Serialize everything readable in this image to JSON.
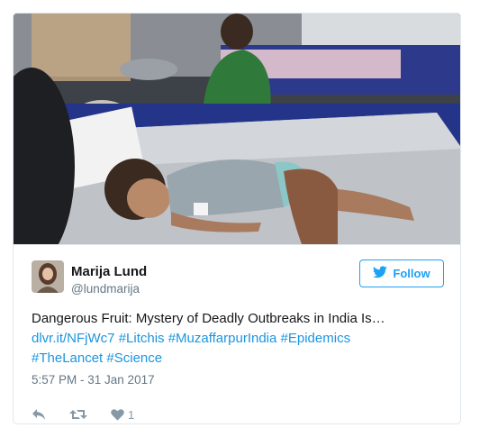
{
  "tweet": {
    "author_name": "Marija Lund",
    "author_handle": "@lundmarija",
    "follow_label": "Follow",
    "text_plain": "Dangerous Fruit: Mystery of Deadly Outbreaks in India Is…",
    "links": [
      "dlvr.it/NFjWc7",
      "#Litchis",
      "#MuzaffarpurIndia",
      "#Epidemics",
      "#TheLancet",
      "#Science"
    ],
    "timestamp": "5:57 PM - 31 Jan 2017",
    "like_count": "1"
  },
  "icons": {
    "follow": "twitter-bird-icon",
    "reply": "reply-icon",
    "retweet": "retweet-icon",
    "like": "heart-icon"
  },
  "colors": {
    "accent": "#1da1f2",
    "link": "#1b95e0",
    "muted": "#657786",
    "border": "#e1e8ed"
  }
}
